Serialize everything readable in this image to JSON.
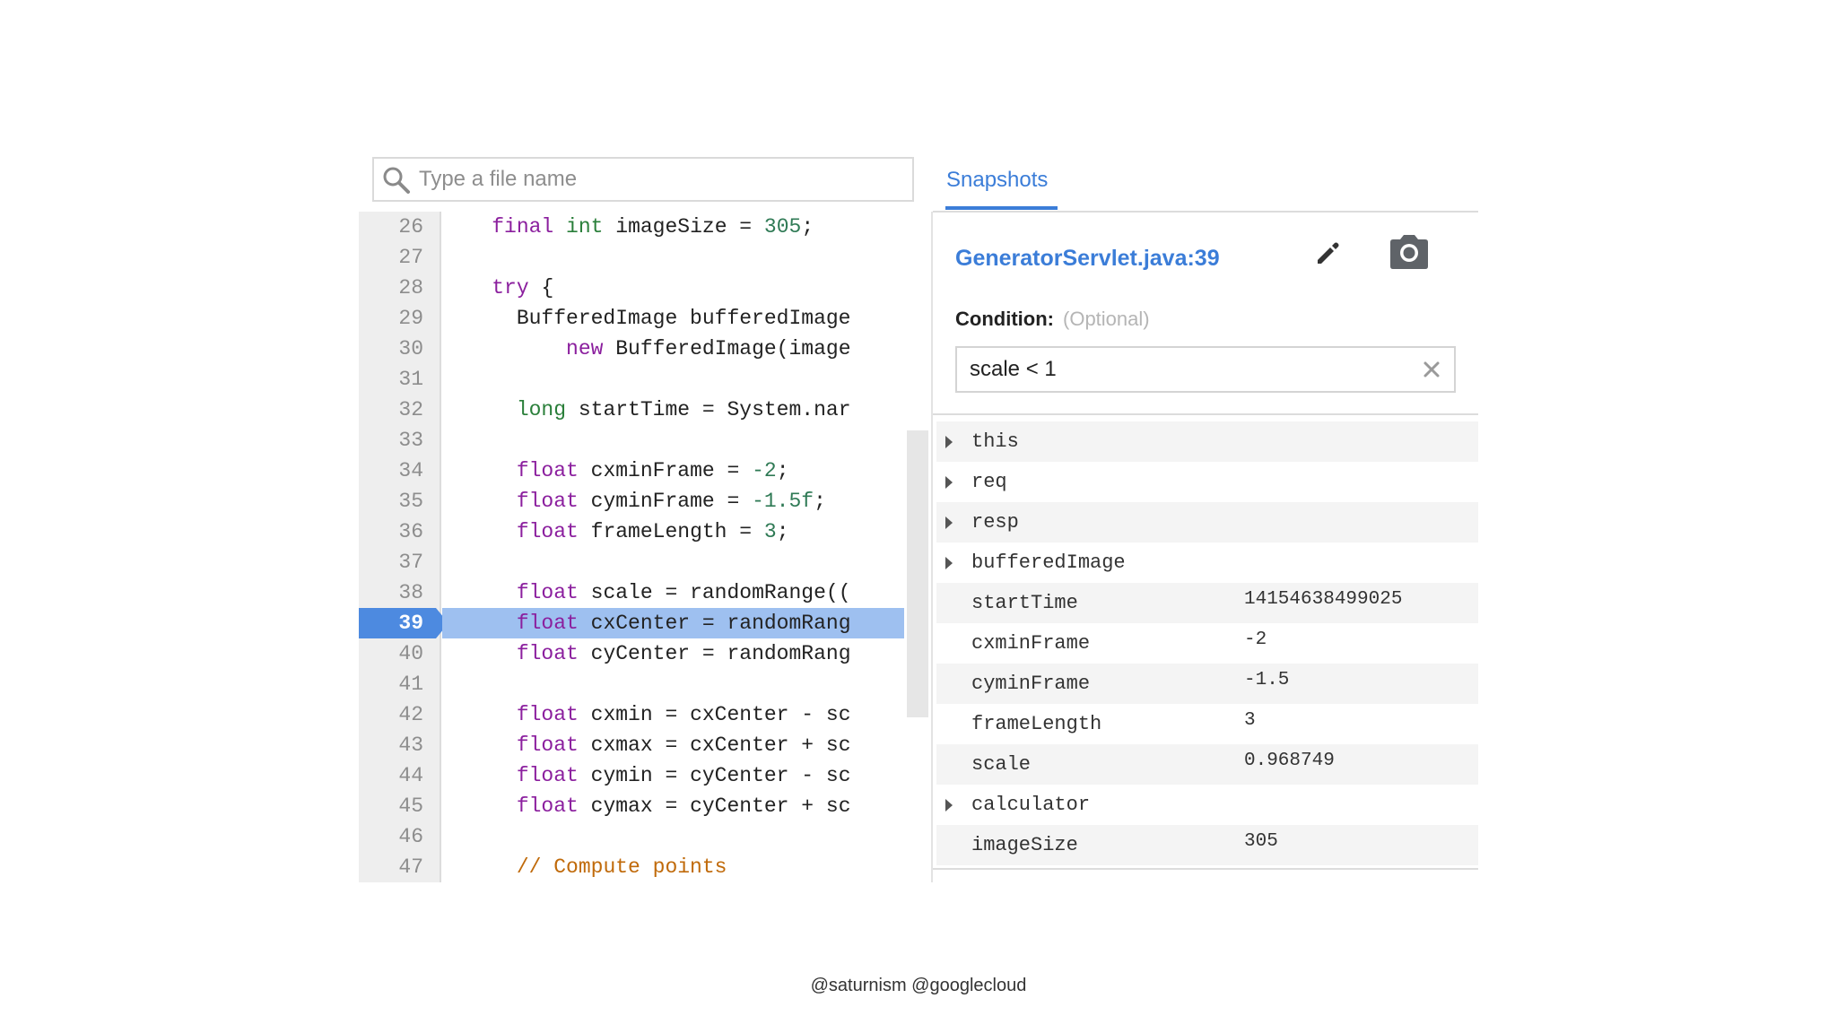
{
  "search": {
    "placeholder": "Type a file name",
    "value": ""
  },
  "editor": {
    "breakpoint_line": "39",
    "lines": [
      {
        "num": "26",
        "tokens": [
          {
            "t": "    "
          },
          {
            "t": "final",
            "c": "kw"
          },
          {
            "t": " "
          },
          {
            "t": "int",
            "c": "ty"
          },
          {
            "t": " imageSize = "
          },
          {
            "t": "305",
            "c": "num"
          },
          {
            "t": ";"
          }
        ]
      },
      {
        "num": "27",
        "tokens": []
      },
      {
        "num": "28",
        "tokens": [
          {
            "t": "    "
          },
          {
            "t": "try",
            "c": "kw"
          },
          {
            "t": " {"
          }
        ]
      },
      {
        "num": "29",
        "tokens": [
          {
            "t": "      BufferedImage bufferedImage"
          }
        ]
      },
      {
        "num": "30",
        "tokens": [
          {
            "t": "          "
          },
          {
            "t": "new",
            "c": "kw"
          },
          {
            "t": " BufferedImage(image"
          }
        ]
      },
      {
        "num": "31",
        "tokens": []
      },
      {
        "num": "32",
        "tokens": [
          {
            "t": "      "
          },
          {
            "t": "long",
            "c": "ty"
          },
          {
            "t": " startTime = System.nar"
          }
        ]
      },
      {
        "num": "33",
        "tokens": []
      },
      {
        "num": "34",
        "tokens": [
          {
            "t": "      "
          },
          {
            "t": "float",
            "c": "kw"
          },
          {
            "t": " cxminFrame = "
          },
          {
            "t": "-2",
            "c": "num"
          },
          {
            "t": ";"
          }
        ]
      },
      {
        "num": "35",
        "tokens": [
          {
            "t": "      "
          },
          {
            "t": "float",
            "c": "kw"
          },
          {
            "t": " cyminFrame = "
          },
          {
            "t": "-1.5f",
            "c": "num"
          },
          {
            "t": ";"
          }
        ]
      },
      {
        "num": "36",
        "tokens": [
          {
            "t": "      "
          },
          {
            "t": "float",
            "c": "kw"
          },
          {
            "t": " frameLength = "
          },
          {
            "t": "3",
            "c": "num"
          },
          {
            "t": ";"
          }
        ]
      },
      {
        "num": "37",
        "tokens": []
      },
      {
        "num": "38",
        "tokens": [
          {
            "t": "      "
          },
          {
            "t": "float",
            "c": "kw"
          },
          {
            "t": " scale = randomRange(("
          }
        ]
      },
      {
        "num": "39",
        "tokens": [
          {
            "t": "      "
          },
          {
            "t": "float",
            "c": "kw"
          },
          {
            "t": " cxCenter = randomRang"
          }
        ]
      },
      {
        "num": "40",
        "tokens": [
          {
            "t": "      "
          },
          {
            "t": "float",
            "c": "kw"
          },
          {
            "t": " cyCenter = randomRang"
          }
        ]
      },
      {
        "num": "41",
        "tokens": []
      },
      {
        "num": "42",
        "tokens": [
          {
            "t": "      "
          },
          {
            "t": "float",
            "c": "kw"
          },
          {
            "t": " cxmin = cxCenter - sc"
          }
        ]
      },
      {
        "num": "43",
        "tokens": [
          {
            "t": "      "
          },
          {
            "t": "float",
            "c": "kw"
          },
          {
            "t": " cxmax = cxCenter + sc"
          }
        ]
      },
      {
        "num": "44",
        "tokens": [
          {
            "t": "      "
          },
          {
            "t": "float",
            "c": "kw"
          },
          {
            "t": " cymin = cyCenter - sc"
          }
        ]
      },
      {
        "num": "45",
        "tokens": [
          {
            "t": "      "
          },
          {
            "t": "float",
            "c": "kw"
          },
          {
            "t": " cymax = cyCenter + sc"
          }
        ]
      },
      {
        "num": "46",
        "tokens": []
      },
      {
        "num": "47",
        "tokens": [
          {
            "t": "      "
          },
          {
            "t": "// Compute points",
            "c": "cmt"
          }
        ]
      }
    ]
  },
  "snapshots": {
    "tab_label": "Snapshots",
    "location": "GeneratorServlet.java:39",
    "edit_icon": "pencil-icon",
    "camera_icon": "camera-icon",
    "condition_label": "Condition:",
    "condition_hint": "(Optional)",
    "condition_value": "scale < 1",
    "variables": [
      {
        "name": "this",
        "value": "",
        "expandable": true
      },
      {
        "name": "req",
        "value": "",
        "expandable": true
      },
      {
        "name": "resp",
        "value": "",
        "expandable": true
      },
      {
        "name": "bufferedImage",
        "value": "",
        "expandable": true
      },
      {
        "name": "startTime",
        "value": "14154638499025",
        "expandable": false
      },
      {
        "name": "cxminFrame",
        "value": "-2",
        "expandable": false
      },
      {
        "name": "cyminFrame",
        "value": "-1.5",
        "expandable": false
      },
      {
        "name": "frameLength",
        "value": "3",
        "expandable": false
      },
      {
        "name": "scale",
        "value": "0.968749",
        "expandable": false
      },
      {
        "name": "calculator",
        "value": "",
        "expandable": true
      },
      {
        "name": "imageSize",
        "value": "305",
        "expandable": false
      }
    ]
  },
  "footer": {
    "text": "@saturnism @googlecloud"
  },
  "colors": {
    "accent": "#3b7dd8",
    "breakpoint": "#4d8ae0",
    "highlight": "#9ec0f0",
    "keyword": "#8b1f9e",
    "type": "#2a7f3a",
    "number": "#2f7a55",
    "comment": "#c06a0a"
  }
}
